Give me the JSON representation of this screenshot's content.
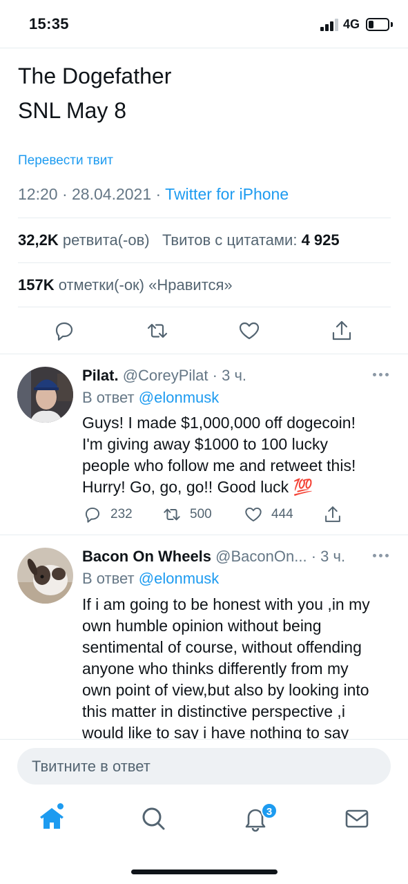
{
  "status_bar": {
    "time": "15:35",
    "network": "4G",
    "signal_bars": 3,
    "battery_level": 0.2
  },
  "tweet": {
    "text_lines": [
      "The Dogefather",
      "SNL May 8"
    ],
    "translate": "Перевести твит",
    "time": "12:20",
    "date": "28.04.2021",
    "source": "Twitter for iPhone",
    "retweets_count": "32,2K",
    "retweets_label": "ретвита(-ов)",
    "quotes_label": "Твитов с цитатами:",
    "quotes_count": "4 925",
    "likes_count": "157K",
    "likes_label": "отметки(-ок) «Нравится»"
  },
  "replies": [
    {
      "name": "Pilat.",
      "handle": "@CoreyPilat",
      "time": "3 ч.",
      "reply_to_label": "В ответ",
      "reply_to": "@elonmusk",
      "text_lines": [
        "Guys! I made $1,000,000 off dogecoin!",
        "I'm giving away $1000 to 100 lucky",
        "people who follow me and retweet this!",
        "Hurry! Go, go, go!! Good luck 💯"
      ],
      "replies": "232",
      "retweets": "500",
      "likes": "444"
    },
    {
      "name": "Bacon On Wheels",
      "handle": "@BaconOn...",
      "time": "3 ч.",
      "reply_to_label": "В ответ",
      "reply_to": "@elonmusk",
      "text_lines": [
        "If i am going to be honest with you ,in my",
        "own humble opinion without being",
        "sentimental of course, without offending",
        "anyone who thinks differently from my",
        "own point of view,but also by looking into",
        "this matter in distinctive perspective ,i",
        "would like to say i have nothing to say"
      ]
    }
  ],
  "compose": {
    "placeholder": "Твитните в ответ"
  },
  "tab_bar": {
    "notifications_badge": "3"
  },
  "colors": {
    "accent": "#1d9bf0",
    "text": "#0f1419",
    "muted": "#657786",
    "divider": "#e6ecf0"
  }
}
